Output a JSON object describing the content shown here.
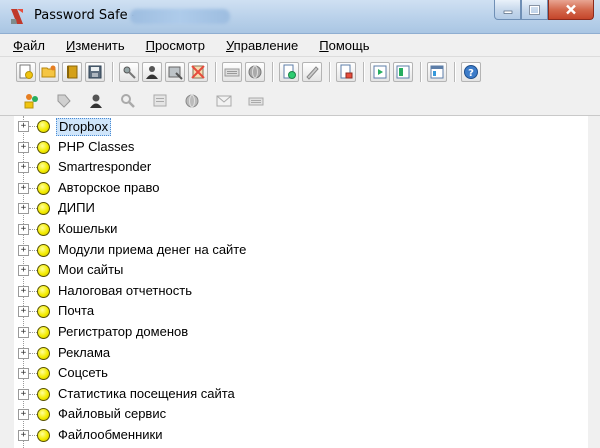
{
  "window": {
    "title": "Password Safe -"
  },
  "menu": [
    {
      "first": "Ф",
      "rest": "айл"
    },
    {
      "first": "И",
      "rest": "зменить"
    },
    {
      "first": "П",
      "rest": "росмотр"
    },
    {
      "first": "У",
      "rest": "правление"
    },
    {
      "first": "П",
      "rest": "омощь"
    }
  ],
  "tree": {
    "selected": "Dropbox",
    "items": [
      "Dropbox",
      "PHP Classes",
      "Smartresponder",
      "Авторское право",
      "ДИПИ",
      "Кошельки",
      "Модули приема денег на сайте",
      "Мои сайты",
      "Налоговая отчетность",
      "Почта",
      "Регистратор доменов",
      "Реклама",
      "Соцсеть",
      "Статистика посещения сайта",
      "Файловый сервис",
      "Файлообменники"
    ],
    "expander_symbol": "+"
  },
  "colors": {
    "selection_bg": "#cfe5fa",
    "group_dot": "#f4ec00",
    "close_button": "#c4452a"
  }
}
